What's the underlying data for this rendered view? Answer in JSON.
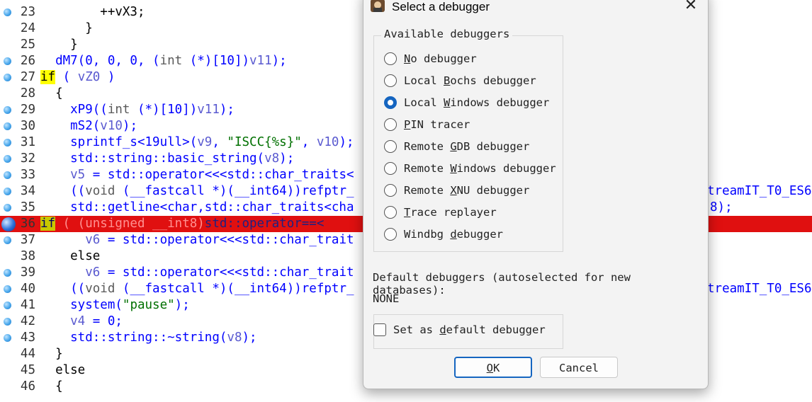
{
  "editor": {
    "lines": [
      {
        "num": "23",
        "bp": true,
        "segs": [
          [
            "b",
            "        ++vX3;"
          ]
        ]
      },
      {
        "num": "24",
        "bp": false,
        "segs": [
          [
            "b",
            "      }"
          ]
        ]
      },
      {
        "num": "25",
        "bp": false,
        "segs": [
          [
            "b",
            "    }"
          ]
        ]
      },
      {
        "num": "26",
        "bp": true,
        "segs": [
          [
            "n",
            "  dM7(0, 0, 0, ("
          ],
          [
            "t",
            "int"
          ],
          [
            "n",
            " (*)[10])"
          ],
          [
            "v",
            "v11"
          ],
          [
            "n",
            ");"
          ]
        ]
      },
      {
        "num": "27",
        "bp": true,
        "segs": [
          [
            "k",
            "if"
          ],
          [
            "n",
            " ( "
          ],
          [
            "v",
            "vZ0"
          ],
          [
            "n",
            " )"
          ]
        ]
      },
      {
        "num": "28",
        "bp": false,
        "segs": [
          [
            "b",
            "  {"
          ]
        ]
      },
      {
        "num": "29",
        "bp": true,
        "segs": [
          [
            "n",
            "    xP9(("
          ],
          [
            "t",
            "int"
          ],
          [
            "n",
            " (*)[10])"
          ],
          [
            "v",
            "v11"
          ],
          [
            "n",
            ");"
          ]
        ]
      },
      {
        "num": "30",
        "bp": true,
        "segs": [
          [
            "n",
            "    mS2("
          ],
          [
            "v",
            "v10"
          ],
          [
            "n",
            ");"
          ]
        ]
      },
      {
        "num": "31",
        "bp": true,
        "segs": [
          [
            "n",
            "    sprintf_s<19ull>("
          ],
          [
            "v",
            "v9"
          ],
          [
            "n",
            ", "
          ],
          [
            "s",
            "\"ISCC{%s}\""
          ],
          [
            "n",
            ", "
          ],
          [
            "v",
            "v10"
          ],
          [
            "n",
            ");"
          ]
        ]
      },
      {
        "num": "32",
        "bp": true,
        "segs": [
          [
            "n",
            "    std::string::basic_string("
          ],
          [
            "v",
            "v8"
          ],
          [
            "n",
            ");"
          ]
        ]
      },
      {
        "num": "33",
        "bp": true,
        "segs": [
          [
            "v",
            "    v5"
          ],
          [
            "n",
            " = std::operator<<<std::char_traits<"
          ]
        ]
      },
      {
        "num": "34",
        "bp": true,
        "segs": [
          [
            "n",
            "    (("
          ],
          [
            "t",
            "void"
          ],
          [
            "n",
            " (__fastcall *)(__int64))refptr_"
          ]
        ]
      },
      {
        "num": "35",
        "bp": true,
        "segs": [
          [
            "n",
            "    std::getline<char,std::char_traits<cha"
          ]
        ]
      },
      {
        "num": "36",
        "bp": "cur",
        "hl": true,
        "segs": [
          [
            "hlk",
            "if"
          ],
          [
            "hw",
            " ( (unsigned __int8)"
          ],
          [
            "hb",
            "std::operator==<"
          ]
        ]
      },
      {
        "num": "37",
        "bp": true,
        "segs": [
          [
            "v",
            "      v6"
          ],
          [
            "n",
            " = std::operator<<<std::char_trait"
          ]
        ]
      },
      {
        "num": "38",
        "bp": false,
        "segs": [
          [
            "b",
            "    else"
          ]
        ]
      },
      {
        "num": "39",
        "bp": true,
        "segs": [
          [
            "v",
            "      v6"
          ],
          [
            "n",
            " = std::operator<<<std::char_trait"
          ]
        ]
      },
      {
        "num": "40",
        "bp": true,
        "segs": [
          [
            "n",
            "    (("
          ],
          [
            "t",
            "void"
          ],
          [
            "n",
            " (__fastcall *)(__int64))refptr_"
          ]
        ]
      },
      {
        "num": "41",
        "bp": true,
        "segs": [
          [
            "n",
            "    system("
          ],
          [
            "s",
            "\"pause\""
          ],
          [
            "n",
            ");"
          ]
        ]
      },
      {
        "num": "42",
        "bp": true,
        "segs": [
          [
            "v",
            "    v4"
          ],
          [
            "n",
            " = 0;"
          ]
        ]
      },
      {
        "num": "43",
        "bp": true,
        "segs": [
          [
            "n",
            "    std::string::~string("
          ],
          [
            "v",
            "v8"
          ],
          [
            "n",
            ");"
          ]
        ]
      },
      {
        "num": "44",
        "bp": false,
        "segs": [
          [
            "b",
            "  }"
          ]
        ]
      },
      {
        "num": "45",
        "bp": false,
        "segs": [
          [
            "b",
            "  else"
          ]
        ]
      },
      {
        "num": "46",
        "bp": false,
        "segs": [
          [
            "b",
            "  {"
          ]
        ]
      }
    ],
    "right_fragments": [
      "treamIT_T0_ES6",
      "8);",
      "treamIT_T0_ES6"
    ]
  },
  "dialog": {
    "title": "Select a debugger",
    "close_glyph": "✕",
    "group_title": "Available debuggers",
    "options": [
      {
        "pre": "",
        "u": "N",
        "post": "o debugger",
        "selected": false
      },
      {
        "pre": "Local ",
        "u": "B",
        "post": "ochs debugger",
        "selected": false
      },
      {
        "pre": "Local ",
        "u": "W",
        "post": "indows debugger",
        "selected": true
      },
      {
        "pre": "",
        "u": "P",
        "post": "IN tracer",
        "selected": false
      },
      {
        "pre": "Remote ",
        "u": "G",
        "post": "DB debugger",
        "selected": false
      },
      {
        "pre": "Remote ",
        "u": "W",
        "post": "indows debugger",
        "selected": false
      },
      {
        "pre": "Remote ",
        "u": "X",
        "post": "NU debugger",
        "selected": false
      },
      {
        "pre": "",
        "u": "T",
        "post": "race replayer",
        "selected": false
      },
      {
        "pre": "Windbg ",
        "u": "d",
        "post": "ebugger",
        "selected": false
      }
    ],
    "default_label": "Default debuggers (autoselected for new databases):",
    "default_value": "NONE",
    "checkbox": {
      "pre": "Set as ",
      "u": "d",
      "post": "efault debugger",
      "checked": false
    },
    "ok": {
      "u": "O",
      "post": "K"
    },
    "cancel": "Cancel"
  }
}
